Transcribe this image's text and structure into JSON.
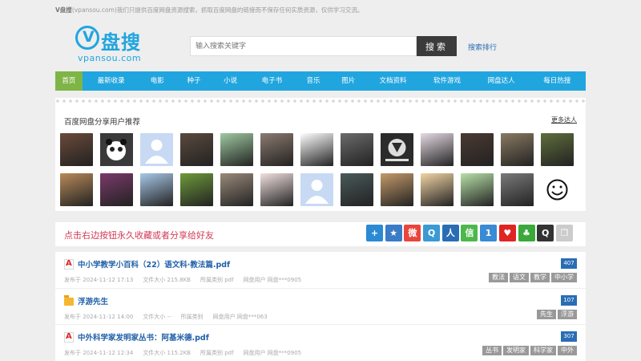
{
  "topbar": {
    "brand": "V盘搜",
    "text": "(vpansou.com)我们只提供百度网盘资源搜索，抓取百度网盘的链接而不保存任何实质资源，仅供学习交流。"
  },
  "logo": {
    "mark": "V",
    "cn": "盘搜",
    "en": "vpansou.com"
  },
  "search": {
    "placeholder": "输入搜索关键字",
    "button": "搜索",
    "rank_link": "搜索排行"
  },
  "nav": [
    {
      "label": "首页",
      "active": true
    },
    {
      "label": "最新收录"
    },
    {
      "label": "电影"
    },
    {
      "label": "种子"
    },
    {
      "label": "小说"
    },
    {
      "label": "电子书"
    },
    {
      "label": "音乐"
    },
    {
      "label": "图片"
    },
    {
      "label": "文档资料"
    },
    {
      "label": "软件游戏"
    },
    {
      "label": "网盘达人"
    },
    {
      "label": "每日热搜"
    }
  ],
  "users": {
    "title": "百度网盘分享用户推荐",
    "more": "更多达人",
    "avatars": [
      {
        "icon": "avatar-photo",
        "color": "#6b4a3a"
      },
      {
        "icon": "panda-avatar",
        "color": "#555555"
      },
      {
        "icon": "default-avatar",
        "color": "#c8d9f3"
      },
      {
        "icon": "avatar-photo",
        "color": "#5a4a3e"
      },
      {
        "icon": "avatar-photo",
        "color": "#9fc9a0"
      },
      {
        "icon": "avatar-photo",
        "color": "#8c7a70"
      },
      {
        "icon": "avatar-photo",
        "color": "#ffffff"
      },
      {
        "icon": "avatar-photo",
        "color": "#6b6b6b"
      },
      {
        "icon": "shield-avatar",
        "color": "#2b2b2b"
      },
      {
        "icon": "avatar-photo",
        "color": "#e6dbe4"
      },
      {
        "icon": "avatar-photo",
        "color": "#4b3a32"
      },
      {
        "icon": "avatar-photo",
        "color": "#8a7a62"
      },
      {
        "icon": "avatar-photo",
        "color": "#5f6e3c"
      },
      {
        "icon": "avatar-photo",
        "color": "#b88a5a"
      },
      {
        "icon": "avatar-photo",
        "color": "#7a3a6a"
      },
      {
        "icon": "avatar-photo",
        "color": "#a8c8e8"
      },
      {
        "icon": "avatar-photo",
        "color": "#6e9a3a"
      },
      {
        "icon": "avatar-photo",
        "color": "#9a8a7a"
      },
      {
        "icon": "avatar-photo",
        "color": "#f2e0e0"
      },
      {
        "icon": "default-avatar",
        "color": "#c8d9f3"
      },
      {
        "icon": "avatar-photo",
        "color": "#4a5a5a"
      },
      {
        "icon": "avatar-photo",
        "color": "#c49a6a"
      },
      {
        "icon": "avatar-photo",
        "color": "#f2d4a4"
      },
      {
        "icon": "avatar-photo",
        "color": "#b8e0a8"
      },
      {
        "icon": "avatar-photo",
        "color": "#7a7a7a"
      },
      {
        "icon": "smiley-avatar",
        "color": "#ffffff"
      }
    ]
  },
  "share": {
    "title": "点击右边按钮永久收藏或者分享给好友",
    "icons": [
      {
        "icon": "plus-icon",
        "color": "#2b8ad4",
        "glyph": "+"
      },
      {
        "icon": "star-icon",
        "color": "#3a7cc6",
        "glyph": "★"
      },
      {
        "icon": "weibo-icon",
        "color": "#e8463c",
        "glyph": "微"
      },
      {
        "icon": "tencent-weibo-icon",
        "color": "#3a9ad4",
        "glyph": "Q"
      },
      {
        "icon": "renren-icon",
        "color": "#2a6db5",
        "glyph": "人"
      },
      {
        "icon": "wechat-icon",
        "color": "#4cb84c",
        "glyph": "信"
      },
      {
        "icon": "one-icon",
        "color": "#3a8ad4",
        "glyph": "1"
      },
      {
        "icon": "heart-icon",
        "color": "#e02424",
        "glyph": "♥"
      },
      {
        "icon": "clover-icon",
        "color": "#3aa83a",
        "glyph": "♣"
      },
      {
        "icon": "qq-icon",
        "color": "#333333",
        "glyph": "Q"
      },
      {
        "icon": "copy-icon",
        "color": "#cccccc",
        "glyph": "❐"
      }
    ]
  },
  "list": [
    {
      "type": "pdf",
      "title": "中小学教学小百科（22）语文科·教法篇.pdf",
      "meta": [
        "发布于 2024-11-12 17:13",
        "文件大小 215.8KB",
        "所属类别 pdf",
        "网盘用户 网盘***0905"
      ],
      "count": "407",
      "tags": [
        "教法",
        "语文",
        "教学",
        "中小学"
      ]
    },
    {
      "type": "folder",
      "title": "浮游先生",
      "meta": [
        "发布于 2024-11-12 14:00",
        "文件大小 --",
        "所属类别",
        "网盘用户 网盘***063"
      ],
      "count": "107",
      "tags": [
        "先生",
        "浮游"
      ]
    },
    {
      "type": "pdf",
      "title": "中外科学家发明家丛书：阿基米德.pdf",
      "meta": [
        "发布于 2024-11-12 12:34",
        "文件大小 115.2KB",
        "所属类别 pdf",
        "网盘用户 网盘***0905"
      ],
      "count": "307",
      "tags": [
        "丛书",
        "发明家",
        "科学家",
        "中外"
      ]
    }
  ]
}
